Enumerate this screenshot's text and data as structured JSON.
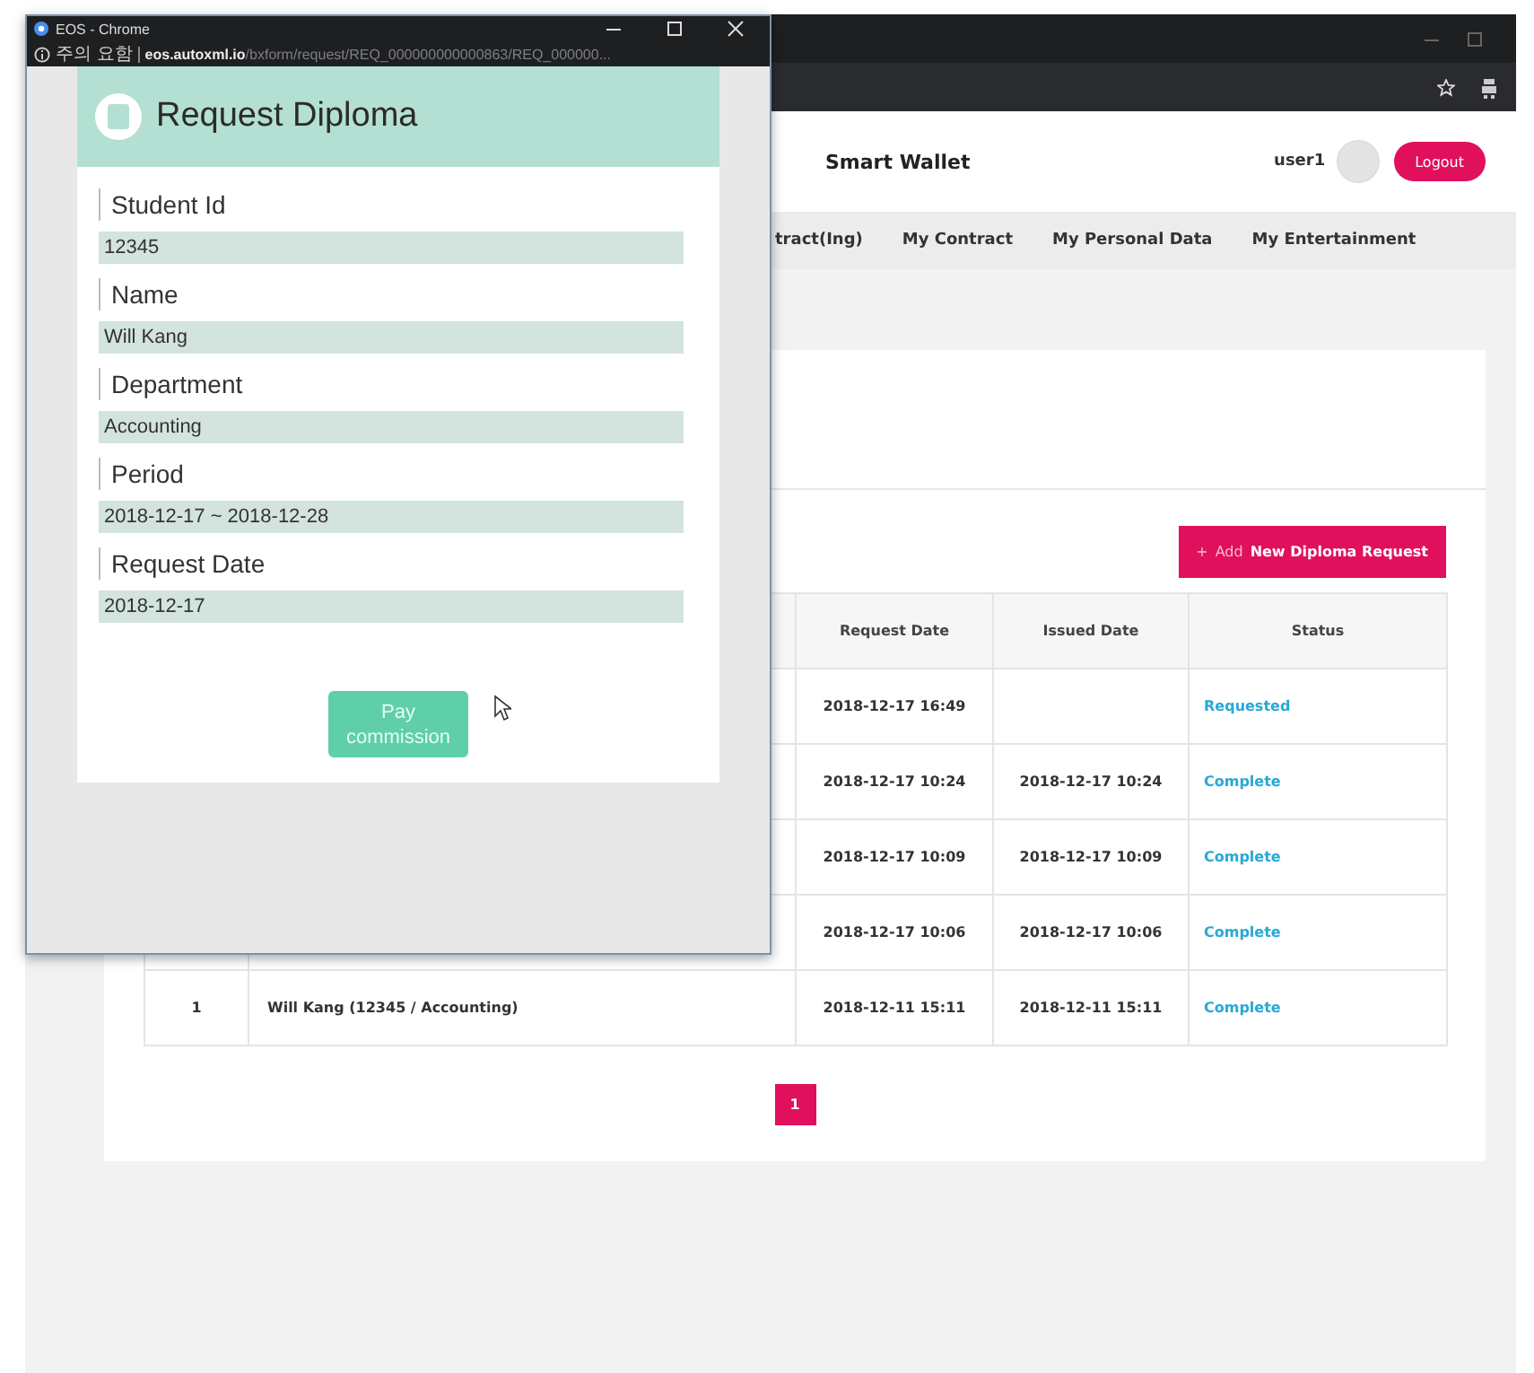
{
  "browser": {
    "nav": [
      "tract(Ing)",
      "My Contract",
      "My Personal Data",
      "My Entertainment"
    ]
  },
  "header": {
    "title": "Smart Wallet",
    "user": "user1",
    "logout": "Logout"
  },
  "add_button": {
    "icon": "+",
    "label_prefix": "Add",
    "label": "New Diploma Request"
  },
  "table": {
    "columns": [
      "Request Date",
      "Issued Date",
      "Status"
    ],
    "rows": [
      {
        "request_date": "2018-12-17 16:49",
        "issued_date": "",
        "status": "Requested"
      },
      {
        "request_date": "2018-12-17 10:24",
        "issued_date": "2018-12-17 10:24",
        "status": "Complete"
      },
      {
        "request_date": "2018-12-17 10:09",
        "issued_date": "2018-12-17 10:09",
        "status": "Complete"
      },
      {
        "request_date": "2018-12-17 10:06",
        "issued_date": "2018-12-17 10:06",
        "status": "Complete"
      },
      {
        "no": "1",
        "name": "Will Kang (12345 / Accounting)",
        "request_date": "2018-12-11 15:11",
        "issued_date": "2018-12-11 15:11",
        "status": "Complete"
      }
    ]
  },
  "pagination": [
    {
      "label": "1",
      "selected": true
    }
  ],
  "popup": {
    "window_title": "EOS - Chrome",
    "warning": "주의 요함",
    "url_host": "eos.autoxml.io",
    "url_path": "/bxform/request/REQ_000000000000863/REQ_000000...",
    "title": "Request Diploma",
    "fields": [
      {
        "label": "Student Id",
        "value": "12345"
      },
      {
        "label": "Name",
        "value": "Will Kang"
      },
      {
        "label": "Department",
        "value": "Accounting"
      },
      {
        "label": "Period",
        "value": "2018-12-17 ~ 2018-12-28"
      },
      {
        "label": "Request Date",
        "value": "2018-12-17"
      }
    ],
    "button": "Pay commission"
  }
}
